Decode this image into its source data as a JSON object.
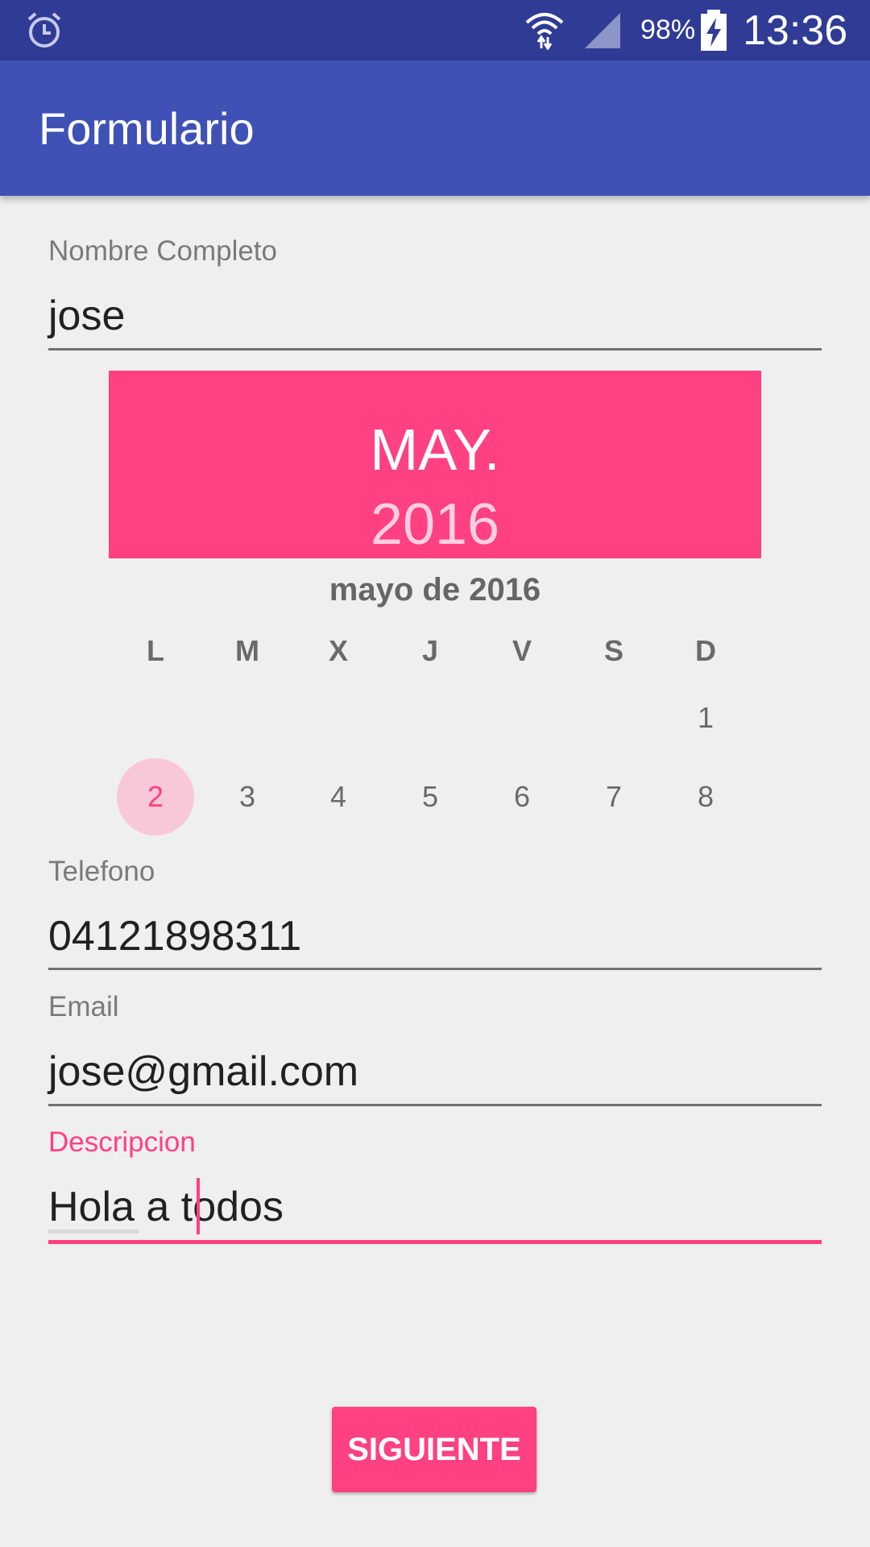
{
  "status_bar": {
    "battery_text": "98%",
    "time": "13:36",
    "icons": [
      "alarm-icon",
      "wifi-icon",
      "signal-icon",
      "battery-charging-icon"
    ]
  },
  "app_bar": {
    "title": "Formulario"
  },
  "form": {
    "nombre": {
      "label": "Nombre Completo",
      "value": "jose"
    },
    "telefono": {
      "label": "Telefono",
      "value": "04121898311"
    },
    "email": {
      "label": "Email",
      "value": "jose@gmail.com"
    },
    "descripcion": {
      "label": "Descripcion",
      "value": "Hola a todos"
    }
  },
  "date_picker": {
    "header_month": "MAY.",
    "header_year": "2016",
    "month_title": "mayo de 2016",
    "weekdays": [
      "L",
      "M",
      "X",
      "J",
      "V",
      "S",
      "D"
    ],
    "days": [
      "1",
      "2",
      "3",
      "4",
      "5",
      "6",
      "7",
      "8"
    ],
    "selected_day": "2"
  },
  "actions": {
    "next_label": "SIGUIENTE"
  },
  "colors": {
    "primary": "#3f51b5",
    "primary_dark": "#2f3b94",
    "accent": "#ff4081"
  }
}
